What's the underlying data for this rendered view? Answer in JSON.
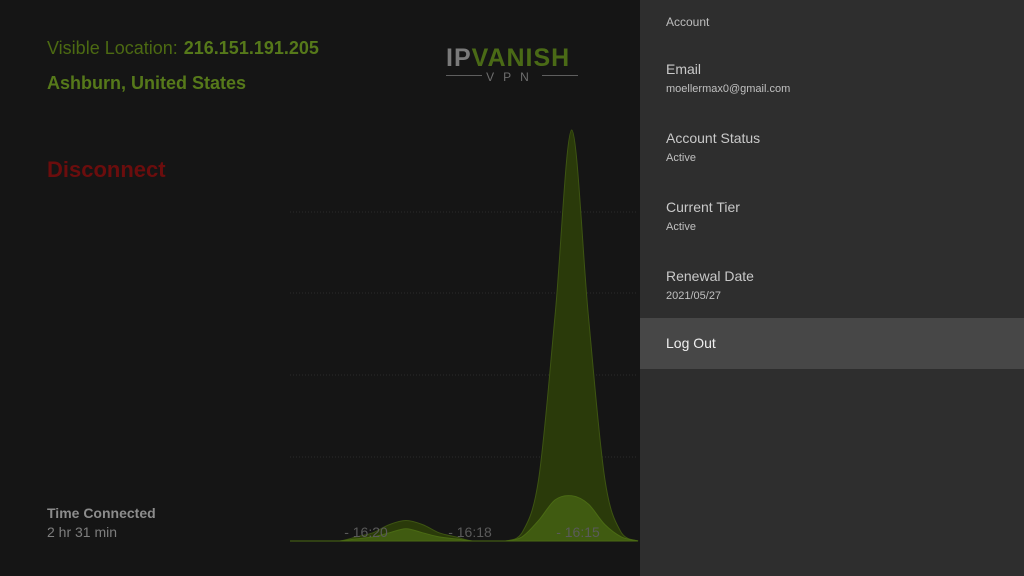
{
  "location": {
    "label": "Visible Location:",
    "ip": "216.151.191.205",
    "city": "Ashburn, United States"
  },
  "actions": {
    "disconnect_label": "Disconnect"
  },
  "logo": {
    "main_prefix": "IP",
    "main_suffix": "VANISH",
    "sub": "VPN"
  },
  "connection": {
    "time_label": "Time Connected",
    "time_value": "2 hr 31 min"
  },
  "chart_data": {
    "type": "area",
    "x_tick_labels": [
      "- 16:20",
      "- 16:18",
      "- 16:15"
    ],
    "series": [
      {
        "values": [
          0,
          0,
          0,
          0,
          0.01,
          0.02,
          0.04,
          0.05,
          0.04,
          0.02,
          0.01,
          0,
          0,
          0,
          0.02,
          0.15,
          0.55,
          1.0,
          0.55,
          0.15,
          0.02,
          0
        ]
      },
      {
        "values": [
          0,
          0,
          0,
          0,
          0.005,
          0.01,
          0.02,
          0.03,
          0.02,
          0.01,
          0.005,
          0,
          0,
          0,
          0.01,
          0.05,
          0.1,
          0.11,
          0.09,
          0.04,
          0.01,
          0
        ]
      }
    ],
    "colors": {
      "fill_main": "#2a3a0a",
      "stroke_main": "#3d5412",
      "fill_inner": "#4a6a14",
      "grid": "#2a2a2a",
      "tick": "#5a5a5a"
    },
    "grid": true,
    "ylim": [
      0,
      1
    ]
  },
  "account": {
    "title": "Account",
    "items": [
      {
        "label": "Email",
        "value": "moellermax0@gmail.com"
      },
      {
        "label": "Account Status",
        "value": "Active"
      },
      {
        "label": "Current Tier",
        "value": "Active"
      },
      {
        "label": "Renewal Date",
        "value": "2021/05/27"
      }
    ],
    "logout_label": "Log Out"
  },
  "colors": {
    "accent_green": "#56791a",
    "disconnect_red": "#6b0d0d",
    "panel_bg": "#2e2e2e",
    "selected_bg": "#474747"
  }
}
